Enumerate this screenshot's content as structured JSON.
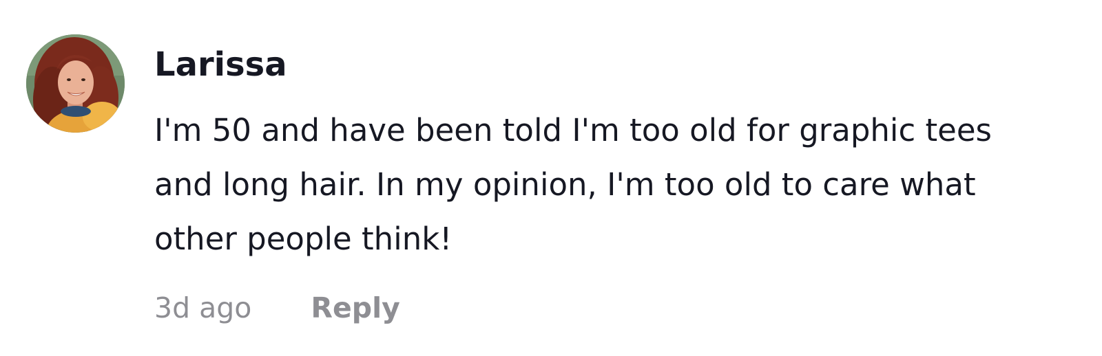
{
  "comment": {
    "username": "Larissa",
    "text": "I'm 50 and have been told I'm too old for graphic tees and long hair. In my opinion, I'm too old to care what other people think!",
    "timestamp": "3d ago",
    "reply_label": "Reply"
  },
  "colors": {
    "text_primary": "#161823",
    "text_secondary": "#8e8e93",
    "background": "#ffffff"
  }
}
